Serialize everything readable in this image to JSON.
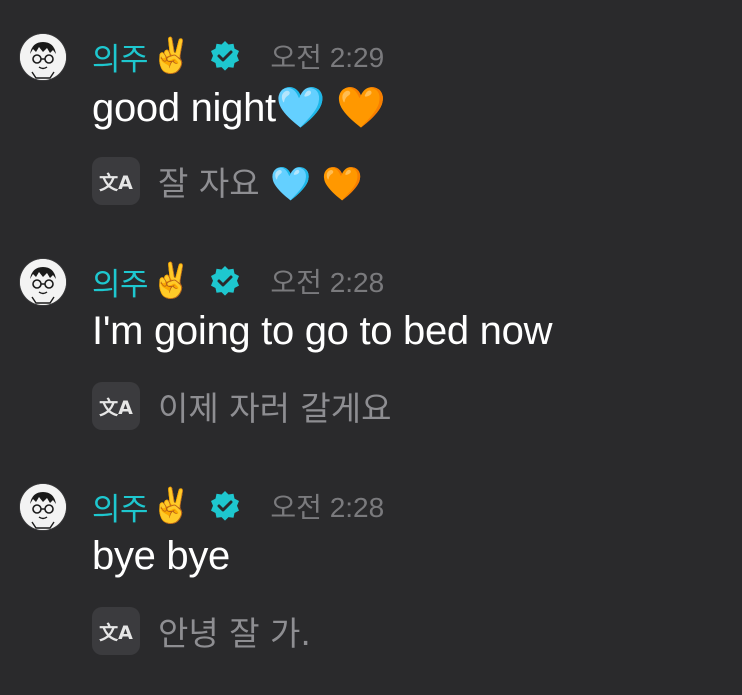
{
  "messages": [
    {
      "author": "의주",
      "author_emoji": "✌️",
      "time": "오전 2:29",
      "text": "good night🩵 🧡",
      "translation": "잘 자요 🩵 🧡"
    },
    {
      "author": "의주",
      "author_emoji": "✌️",
      "time": "오전 2:28",
      "text": "I'm going to go to bed now",
      "translation": "이제 자러 갈게요"
    },
    {
      "author": "의주",
      "author_emoji": "✌️",
      "time": "오전 2:28",
      "text": "bye bye",
      "translation": "안녕 잘 가."
    }
  ],
  "icons": {
    "avatar": "cartoon-face-avatar",
    "verified": "verified-badge-icon",
    "translate": "translate-icon"
  },
  "colors": {
    "background": "#2a2a2c",
    "author": "#1ec7cf",
    "verified": "#1ec7cf",
    "timestamp": "#7a7a7d",
    "translation": "#8e8e92"
  },
  "translate_glyph": "文A"
}
